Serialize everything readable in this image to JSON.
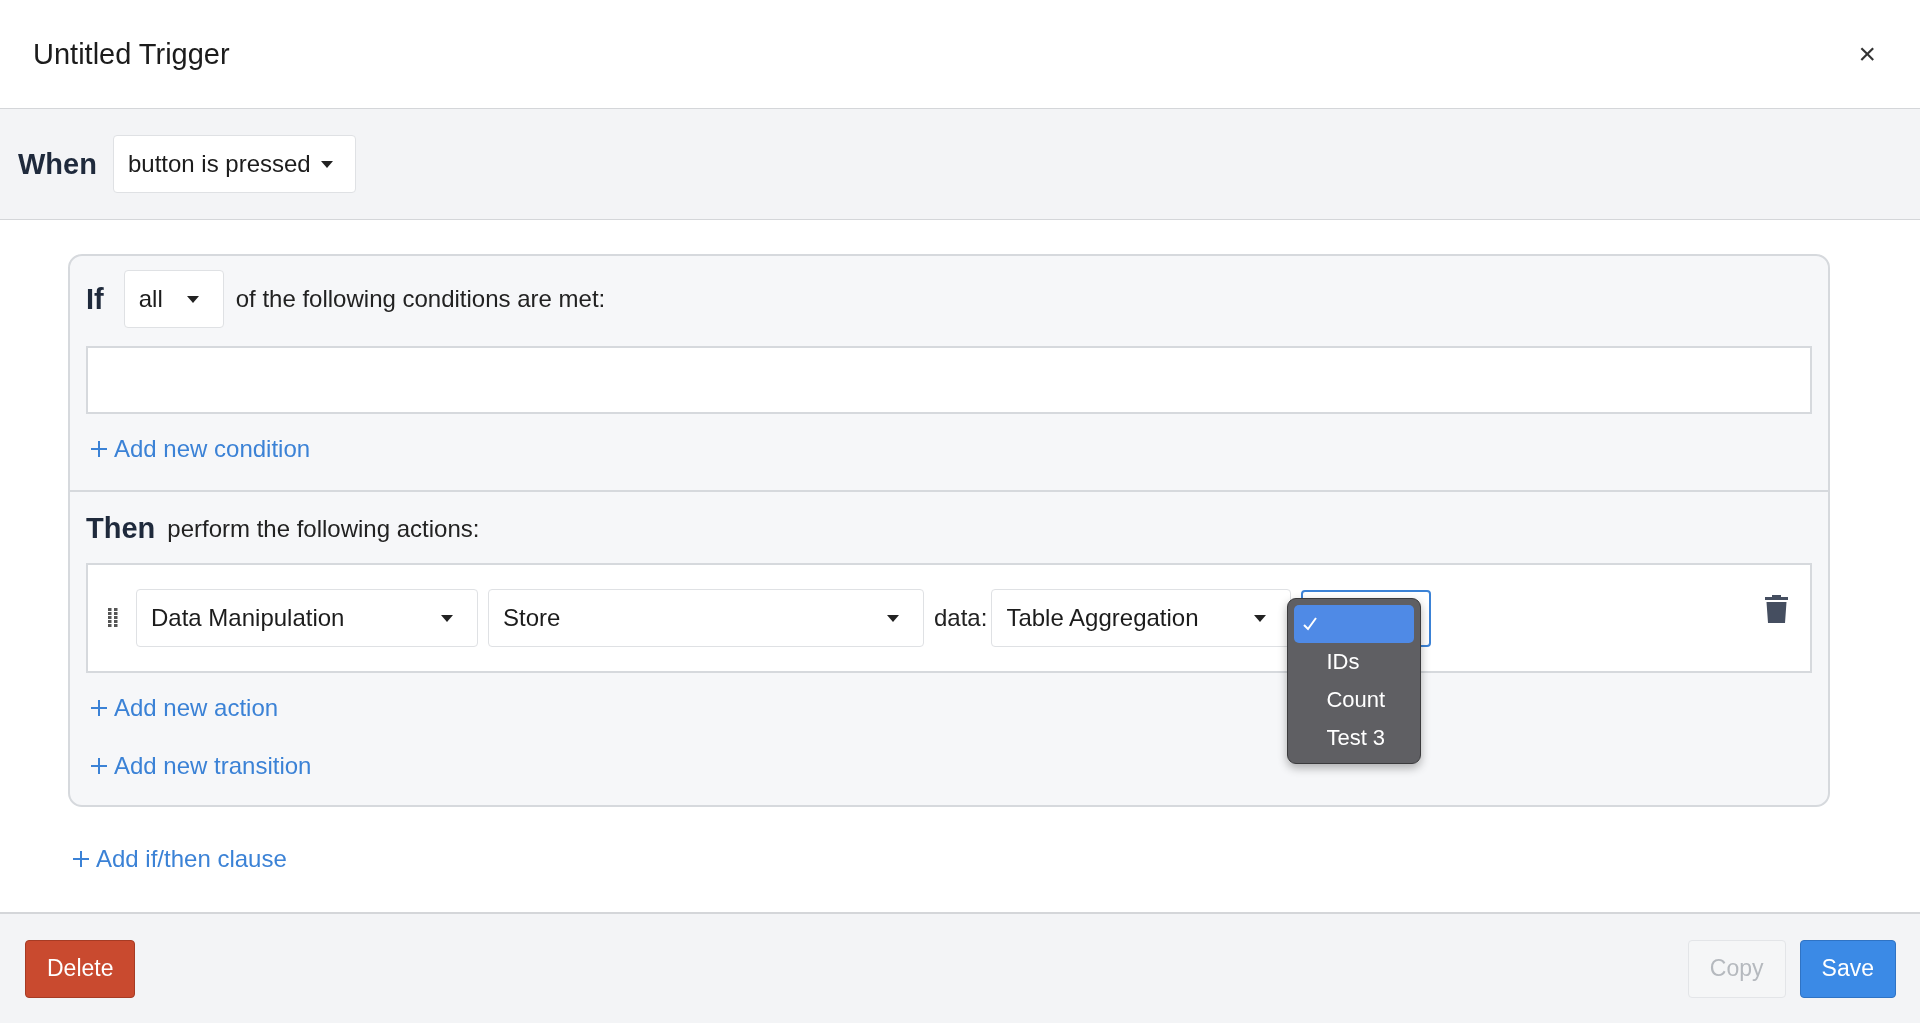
{
  "dialog": {
    "title": "Untitled Trigger",
    "close": "×"
  },
  "when": {
    "label": "When",
    "event": "button is pressed"
  },
  "clause": {
    "if_label": "If",
    "quantifier": "all",
    "condition_text": "of the following conditions are met:",
    "add_condition": "Add new condition",
    "then_label": "Then",
    "then_text": "perform the following actions:",
    "actions": [
      {
        "category": "Data Manipulation",
        "operation": "Store",
        "data_label": "data:",
        "data_source": "Table Aggregation",
        "field": {
          "expanded": true,
          "options": [
            {
              "selected": true
            },
            {
              "label": "IDs",
              "selected": false
            },
            {
              "label": "Count",
              "selected": false
            },
            {
              "label": "Test 3",
              "selected": false
            }
          ]
        }
      }
    ],
    "add_action": "Add new action",
    "add_transition": "Add new transition"
  },
  "add_clause": "Add if/then clause",
  "footer": [
    {
      "label": "Delete",
      "kind": "danger",
      "disabled": false
    },
    {
      "label": "Copy",
      "kind": "secondary",
      "disabled": true
    },
    {
      "label": "Save",
      "kind": "primary",
      "disabled": false
    }
  ]
}
